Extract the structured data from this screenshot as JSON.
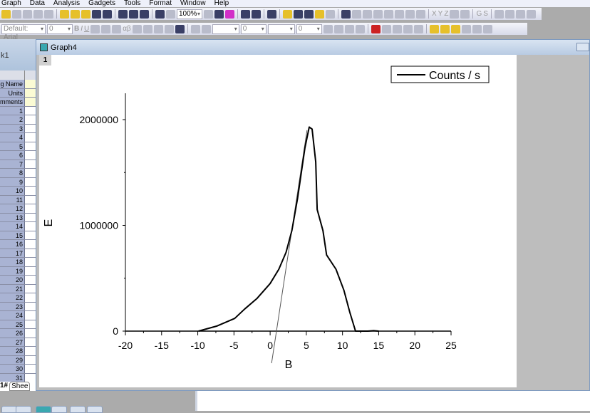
{
  "menu": [
    "Graph",
    "Data",
    "Analysis",
    "Gadgets",
    "Tools",
    "Format",
    "Window",
    "Help"
  ],
  "toolbar": {
    "zoom": "100%",
    "font": "Default: Arial",
    "font_size": "0",
    "line_width": "0",
    "border_width": "0",
    "labels": {
      "bold": "B",
      "italic": "I",
      "underline": "U",
      "greek": "αβ",
      "x": "X",
      "y": "Y",
      "z": "Z",
      "g": "G",
      "s": "S"
    }
  },
  "workbook": {
    "title": "k1",
    "header_rows": [
      "g Name",
      "Units",
      "mments"
    ],
    "rows": [
      "1",
      "2",
      "3",
      "4",
      "5",
      "6",
      "7",
      "8",
      "9",
      "10",
      "11",
      "12",
      "13",
      "14",
      "15",
      "16",
      "17",
      "18",
      "19",
      "20",
      "21",
      "22",
      "23",
      "24",
      "25",
      "26",
      "27",
      "28",
      "29",
      "30",
      "31"
    ],
    "sheet_tab": "1#",
    "sheet_label": "Shee"
  },
  "graph": {
    "title": "Graph4",
    "layer": "1"
  },
  "chart_data": {
    "type": "line",
    "xlabel": "B",
    "ylabel": "E",
    "xlim": [
      -20,
      25
    ],
    "ylim": [
      0,
      2000000
    ],
    "xticks": [
      "-20",
      "-15",
      "-10",
      "-5",
      "0",
      "5",
      "10",
      "15",
      "20",
      "25"
    ],
    "yticks": [
      "0",
      "1000000",
      "2000000"
    ],
    "legend": {
      "entries": [
        "Counts / s"
      ],
      "placement": "top-right"
    },
    "series": [
      {
        "name": "Counts / s",
        "x": [
          -9.9,
          -7.4,
          -4.9,
          -3.5,
          -1.8,
          0,
          1.2,
          2.2,
          3,
          3.8,
          4.8,
          5.4,
          5.8,
          6.3,
          6.5,
          7.3,
          7.8,
          9.1,
          10.2,
          11,
          11.8,
          13.5,
          14.3,
          15
        ],
        "y": [
          0,
          47000,
          120000,
          210000,
          310000,
          450000,
          585000,
          745000,
          950000,
          1260000,
          1730000,
          1930000,
          1910000,
          1600000,
          1150000,
          950000,
          720000,
          585000,
          385000,
          180000,
          0,
          0,
          4000,
          0
        ]
      },
      {
        "name": "fit line",
        "x": [
          0.2,
          5.1
        ],
        "y": [
          -303000,
          1900000
        ]
      }
    ]
  }
}
